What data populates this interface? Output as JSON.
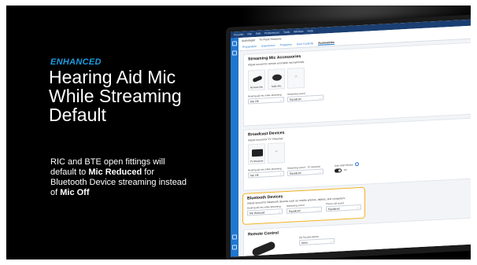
{
  "slide": {
    "badge": "ENHANCED",
    "headline": "Hearing Aid Mic While Streaming Default",
    "body_pre": "RIC and BTE open fittings will default to ",
    "body_bold1": "Mic Reduced",
    "body_mid": " for Bluetooth Device streaming instead of ",
    "body_bold2": "Mic Off"
  },
  "app": {
    "menubar": [
      "Flourish",
      "File",
      "Edit",
      "Preferences",
      "Tools",
      "Window",
      "Help"
    ],
    "patient_tab": "Audiologist",
    "session_tab": "TV Pack Sessions",
    "nav": [
      "Preparation",
      "Experience",
      "Programs",
      "User Controls",
      "Accessories"
    ],
    "active_nav": "Accessories",
    "streaming_mic": {
      "title": "Streaming Mic Accessories",
      "subtitle": "Adjust sound for remote and table microphones.",
      "tiles": [
        "Remote Mic",
        "Table Mic"
      ],
      "mic_label": "Hearing aid mic while streaming",
      "mic_value": "Mic Off",
      "sound_label": "Streaming sound",
      "sound_value": "Equalized"
    },
    "broadcast": {
      "title": "Broadcast Devices",
      "subtitle": "Adjust sound for TV Streamer.",
      "tile": "TV Streamer",
      "mic_label": "Hearing aid mic while streaming",
      "mic_value": "Mic Off",
      "sound_label": "Streaming sound - TV Streamer",
      "sound_value": "Equalized",
      "autostart_label": "Auto Start Stream",
      "autostart_value": "On"
    },
    "bluetooth": {
      "title": "Bluetooth Devices",
      "subtitle": "Adjust sound for Bluetooth devices such as mobile phones, tablets, and computers.",
      "mic_label": "Hearing aid mic while streaming",
      "mic_value": "Mic Reduced",
      "sound_label": "Streaming sound",
      "sound_value": "Equalized",
      "phone_label": "Phone call sound",
      "phone_value": "Equalized"
    },
    "remote": {
      "title": "Remote Control",
      "button_label": "(S) Favorite Button",
      "button_value": "None"
    }
  },
  "colors": {
    "accent": "#1e9be0",
    "highlight": "#f3b325",
    "rail": "#1f77d0"
  }
}
